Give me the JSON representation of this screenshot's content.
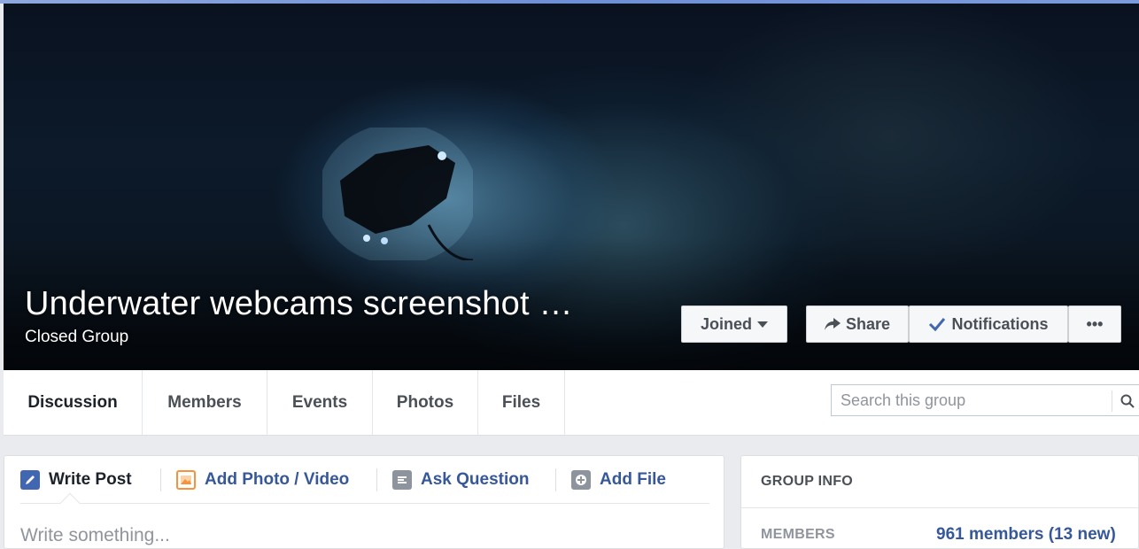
{
  "cover": {
    "title": "Underwater webcams screenshot …",
    "privacy": "Closed Group"
  },
  "actions": {
    "joined": "Joined",
    "share": "Share",
    "notifications": "Notifications",
    "more": "•••"
  },
  "tabs": [
    {
      "label": "Discussion"
    },
    {
      "label": "Members"
    },
    {
      "label": "Events"
    },
    {
      "label": "Photos"
    },
    {
      "label": "Files"
    }
  ],
  "search": {
    "placeholder": "Search this group",
    "icon": "search-icon"
  },
  "composer": {
    "tabs": [
      {
        "label": "Write Post",
        "icon": "pencil-icon",
        "color": "#4267b2"
      },
      {
        "label": "Add Photo / Video",
        "icon": "photo-icon",
        "color": "#f7923b"
      },
      {
        "label": "Ask Question",
        "icon": "list-icon",
        "color": "#8d949e"
      },
      {
        "label": "Add File",
        "icon": "plus-icon",
        "color": "#8d949e"
      }
    ],
    "placeholder": "Write something..."
  },
  "group_info": {
    "heading": "GROUP INFO",
    "members_label": "MEMBERS",
    "members_value": "961 members (13 new)"
  },
  "colors": {
    "link": "#365899",
    "background": "#e9ebee",
    "accent": "#4267b2"
  }
}
